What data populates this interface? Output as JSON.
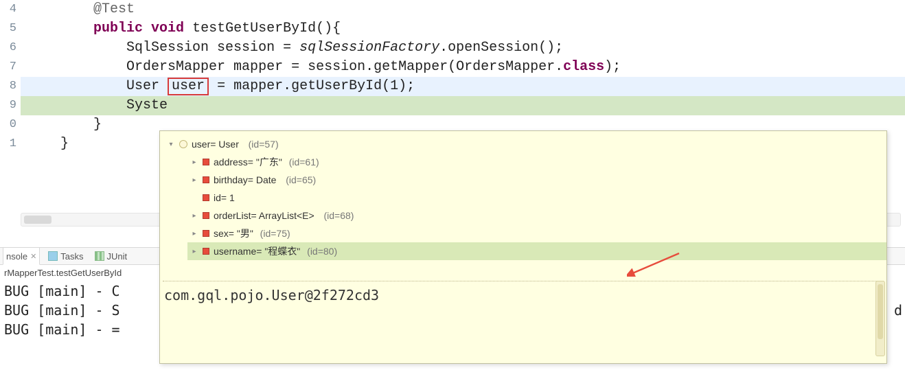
{
  "gutter": [
    "4",
    "5",
    "6",
    "7",
    "8",
    "9",
    "0",
    "1"
  ],
  "code": {
    "l1_annotation": "@Test",
    "l2_kw1": "public",
    "l2_kw2": "void",
    "l2_rest": " testGetUserById(){",
    "l3_a": "SqlSession session = ",
    "l3_b": "sqlSessionFactory",
    "l3_c": ".openSession();",
    "l4_a": "OrdersMapper mapper = session.getMapper(OrdersMapper.",
    "l4_kw": "class",
    "l4_b": ");",
    "l5_a": "User ",
    "l5_box": "user",
    "l5_b": " = mapper.getUserById(1);",
    "l6": "Syste",
    "l7": "}",
    "l8": "}"
  },
  "tabs": {
    "console": "nsole",
    "tasks": "Tasks",
    "junit": "JUnit"
  },
  "breadcrumb": "rMapperTest.testGetUserById",
  "console": {
    "r1": "BUG [main] - C",
    "r2": "BUG [main] - S",
    "r3": "BUG [main] - =",
    "r2_tail": "d"
  },
  "popup": {
    "root": {
      "label": "user= User",
      "meta": "  (id=57)"
    },
    "children": [
      {
        "twisty": "col",
        "label": "address= \"广东\"",
        "meta": " (id=61)"
      },
      {
        "twisty": "col",
        "label": "birthday= Date",
        "meta": "  (id=65)"
      },
      {
        "twisty": "none",
        "label": "id= 1",
        "meta": ""
      },
      {
        "twisty": "col",
        "label": "orderList= ArrayList<E>",
        "meta": "  (id=68)"
      },
      {
        "twisty": "col",
        "label": "sex= \"男\"",
        "meta": " (id=75)"
      },
      {
        "twisty": "col",
        "label": "username= \"程蝶衣\"",
        "meta": " (id=80)",
        "selected": true
      }
    ],
    "tostring": "com.gql.pojo.User@2f272cd3"
  }
}
